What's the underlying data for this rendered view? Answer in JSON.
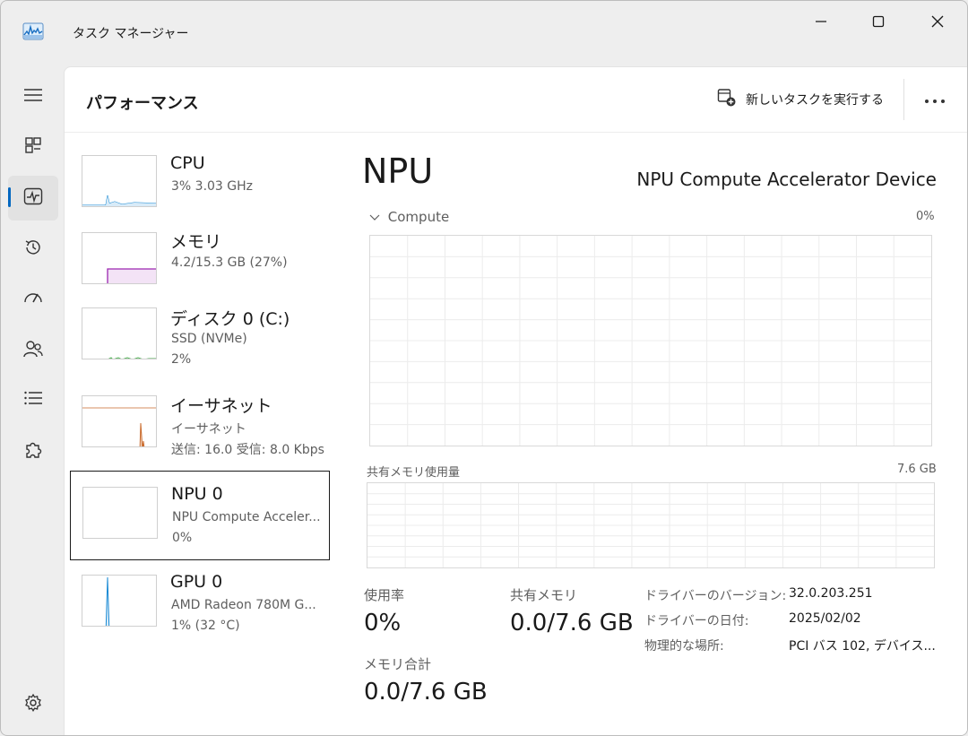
{
  "window": {
    "title": "タスク マネージャー",
    "icons": {
      "app": "activity-chart-icon",
      "minimize": "minimize-icon",
      "maximize": "maximize-icon",
      "close": "close-icon"
    }
  },
  "nav": {
    "items": [
      {
        "id": "menu",
        "icon": "hamburger-icon",
        "active": false
      },
      {
        "id": "processes",
        "icon": "processes-icon",
        "active": false
      },
      {
        "id": "performance",
        "icon": "performance-icon",
        "active": true
      },
      {
        "id": "app-history",
        "icon": "history-icon",
        "active": false
      },
      {
        "id": "startup",
        "icon": "speedometer-icon",
        "active": false
      },
      {
        "id": "users",
        "icon": "users-icon",
        "active": false
      },
      {
        "id": "details",
        "icon": "list-icon",
        "active": false
      },
      {
        "id": "services",
        "icon": "puzzle-icon",
        "active": false
      },
      {
        "id": "settings",
        "icon": "gear-icon",
        "active": false
      }
    ]
  },
  "header": {
    "title": "パフォーマンス",
    "run_task_label": "新しいタスクを実行する"
  },
  "devices": [
    {
      "id": "cpu",
      "name": "CPU",
      "line1": "3%  3.03 GHz",
      "line2": "",
      "color": "#1a8ad4",
      "selected": false
    },
    {
      "id": "memory",
      "name": "メモリ",
      "line1": "4.2/15.3 GB (27%)",
      "line2": "",
      "color": "#9c27b0",
      "selected": false
    },
    {
      "id": "disk",
      "name": "ディスク 0 (C:)",
      "line1": "SSD (NVMe)",
      "line2": "2%",
      "color": "#4caf50",
      "selected": false
    },
    {
      "id": "ethernet",
      "name": "イーサネット",
      "line1": "イーサネット",
      "line2": "送信: 16.0  受信: 8.0 Kbps",
      "color": "#c9692a",
      "selected": false
    },
    {
      "id": "npu",
      "name": "NPU 0",
      "line1": "NPU Compute Acceler...",
      "line2": "0%",
      "color": "#1a8ad4",
      "selected": true
    },
    {
      "id": "gpu",
      "name": "GPU 0",
      "line1": "AMD Radeon 780M G...",
      "line2": "1% (32 °C)",
      "color": "#1a8ad4",
      "selected": false
    }
  ],
  "detail": {
    "title": "NPU",
    "device_name": "NPU Compute Accelerator Device",
    "graph_label": "Compute",
    "graph_max": "0%",
    "memory_graph_label": "共有メモリ使用量",
    "memory_graph_max": "7.6 GB",
    "stats": {
      "usage_label": "使用率",
      "usage_value": "0%",
      "shared_mem_label": "共有メモリ",
      "shared_mem_value": "0.0/7.6 GB",
      "mem_total_label": "メモリ合計",
      "mem_total_value": "0.0/7.6 GB"
    },
    "properties": [
      {
        "key": "ドライバーのバージョン:",
        "value": "32.0.203.251"
      },
      {
        "key": "ドライバーの日付:",
        "value": "2025/02/02"
      },
      {
        "key": "物理的な場所:",
        "value": "PCI バス 102, デバイス..."
      }
    ]
  }
}
